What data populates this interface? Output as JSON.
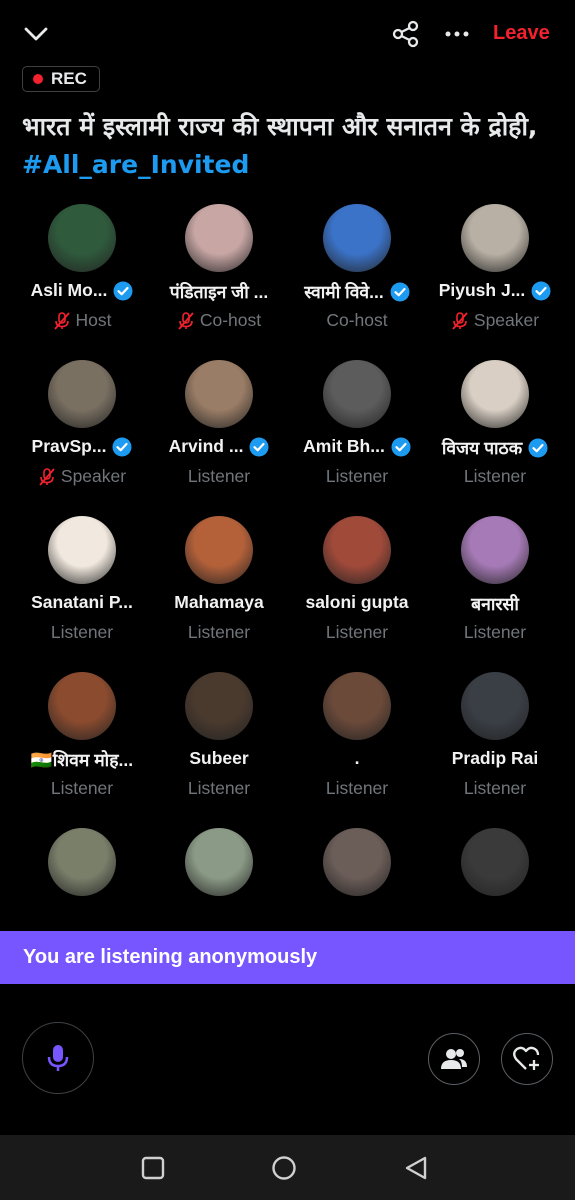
{
  "header": {
    "leave_label": "Leave",
    "rec_label": "REC",
    "title_text": "भारत में इस्लामी राज्य की स्थापना और सनातन के द्रोही, ",
    "title_hashtag": "#All_are_Invited"
  },
  "participants": [
    {
      "name": "Asli Mo...",
      "role": "Host",
      "verified": true,
      "muted": true,
      "avatar_color": "#2f5a3c"
    },
    {
      "name": "पंडिताइन जी ...",
      "role": "Co-host",
      "verified": false,
      "muted": true,
      "avatar_color": "#c7a6a4"
    },
    {
      "name": "स्वामी विवे...",
      "role": "Co-host",
      "verified": true,
      "muted": false,
      "avatar_color": "#3b73c9"
    },
    {
      "name": "Piyush J...",
      "role": "Speaker",
      "verified": true,
      "muted": true,
      "avatar_color": "#b8b0a4"
    },
    {
      "name": "PravSp...",
      "role": "Speaker",
      "verified": true,
      "muted": true,
      "avatar_color": "#7a7062"
    },
    {
      "name": "Arvind ...",
      "role": "Listener",
      "verified": true,
      "muted": false,
      "avatar_color": "#9a7d66"
    },
    {
      "name": "Amit Bh...",
      "role": "Listener",
      "verified": true,
      "muted": false,
      "avatar_color": "#5c5c5c"
    },
    {
      "name": "विजय पाठक",
      "role": "Listener",
      "verified": true,
      "muted": false,
      "avatar_color": "#d9cfc4"
    },
    {
      "name": "Sanatani P...",
      "role": "Listener",
      "verified": false,
      "muted": false,
      "avatar_color": "#f1e9df"
    },
    {
      "name": "Mahamaya",
      "role": "Listener",
      "verified": false,
      "muted": false,
      "avatar_color": "#b4613a"
    },
    {
      "name": "saloni gupta",
      "role": "Listener",
      "verified": false,
      "muted": false,
      "avatar_color": "#a04a3a"
    },
    {
      "name": "बनारसी",
      "role": "Listener",
      "verified": false,
      "muted": false,
      "avatar_color": "#a67ab6"
    },
    {
      "name": "🇮🇳शिवम मोह...",
      "role": "Listener",
      "verified": false,
      "muted": false,
      "avatar_color": "#8a4b2f"
    },
    {
      "name": "Subeer",
      "role": "Listener",
      "verified": false,
      "muted": false,
      "avatar_color": "#4a3a2e"
    },
    {
      "name": ".",
      "role": "Listener",
      "verified": false,
      "muted": false,
      "avatar_color": "#6b4a3a"
    },
    {
      "name": "Pradip Rai",
      "role": "Listener",
      "verified": false,
      "muted": false,
      "avatar_color": "#3a3f46"
    },
    {
      "name": "",
      "role": "",
      "verified": false,
      "muted": false,
      "avatar_color": "#7a7f6a"
    },
    {
      "name": "",
      "role": "",
      "verified": false,
      "muted": false,
      "avatar_color": "#8b9a86"
    },
    {
      "name": "",
      "role": "",
      "verified": false,
      "muted": false,
      "avatar_color": "#6b5d58"
    },
    {
      "name": "",
      "role": "",
      "verified": false,
      "muted": false,
      "avatar_color": "#3a3a3a"
    }
  ],
  "banner": {
    "text": "You are listening anonymously"
  },
  "colors": {
    "accent": "#1d9bf0",
    "leave": "#f4212e",
    "banner": "#7856ff",
    "mic": "#7856ff"
  },
  "icons": [
    "chevron-down-icon",
    "share-icon",
    "more-icon",
    "mic-icon",
    "people-icon",
    "heart-plus-icon",
    "nav-recents-icon",
    "nav-home-icon",
    "nav-back-icon"
  ]
}
